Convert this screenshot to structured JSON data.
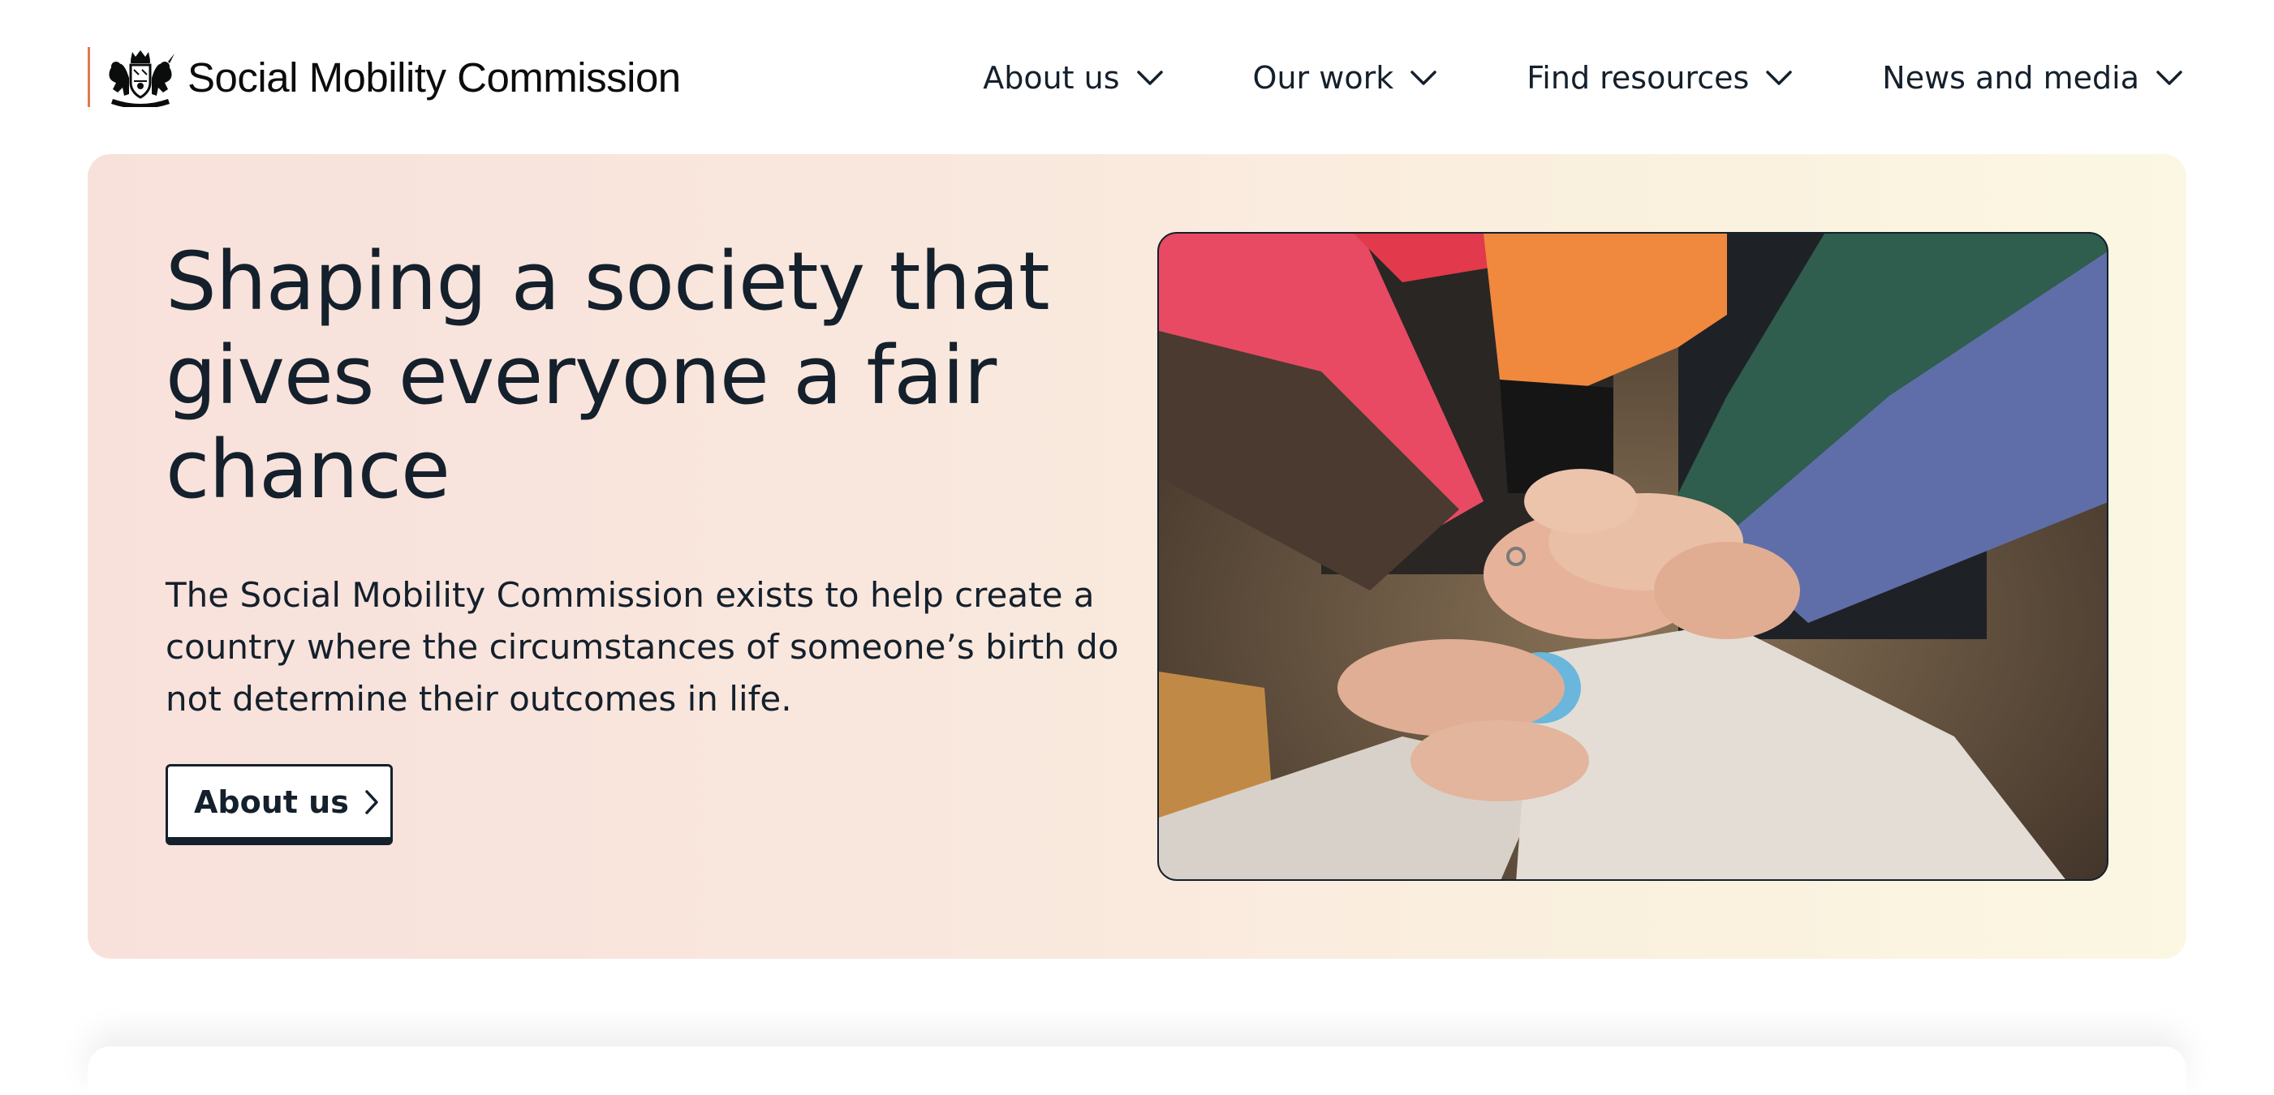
{
  "header": {
    "brand_name": "Social Mobility Commission",
    "logo_icon": "royal-coat-of-arms-icon",
    "accent_color": "#e0794a"
  },
  "nav": {
    "items": [
      {
        "label": "About us",
        "icon": "chevron-down-icon"
      },
      {
        "label": "Our work",
        "icon": "chevron-down-icon"
      },
      {
        "label": "Find resources",
        "icon": "chevron-down-icon"
      },
      {
        "label": "News and media",
        "icon": "chevron-down-icon"
      }
    ]
  },
  "hero": {
    "title": "Shaping a society that gives everyone a fair chance",
    "text": "The Social Mobility Commission exists to help create a country where the circumstances of someone’s birth do not determine their outcomes in life.",
    "button_label": "About us",
    "button_icon": "chevron-right-icon",
    "image_icon": "stacked-hands-photo",
    "background_colors": [
      "#f8e1db",
      "#fbf7e2"
    ],
    "text_color": "#14202c"
  }
}
